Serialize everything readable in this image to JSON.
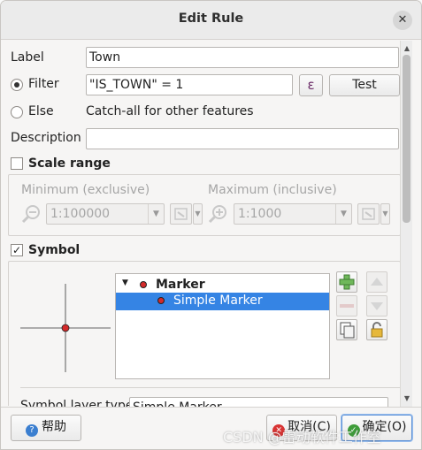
{
  "window": {
    "title": "Edit Rule"
  },
  "form": {
    "label_caption": "Label",
    "label_value": "Town",
    "filter_caption": "Filter",
    "filter_value": "\"IS_TOWN\" = 1",
    "expression_symbol": "ε",
    "test_label": "Test",
    "else_caption": "Else",
    "else_text": "Catch-all for other features",
    "description_caption": "Description",
    "description_value": ""
  },
  "scale_range": {
    "title": "Scale range",
    "checked": false,
    "min_caption": "Minimum (exclusive)",
    "min_value": "1:100000",
    "max_caption": "Maximum (inclusive)",
    "max_value": "1:1000"
  },
  "symbol": {
    "title": "Symbol",
    "checked": true,
    "check_mark": "✓",
    "tree": [
      {
        "label": "Marker",
        "bold": true
      },
      {
        "label": "Simple Marker",
        "bold": false
      }
    ],
    "symbol_layer_caption": "Symbol layer type",
    "symbol_layer_value": "Simple Marker",
    "marker_color": "#d42a2a"
  },
  "footer": {
    "help_label": "帮助",
    "cancel_label": "取消(C)",
    "ok_label": "确定(O)"
  },
  "watermark": "CSDN @雷动软件工作室"
}
